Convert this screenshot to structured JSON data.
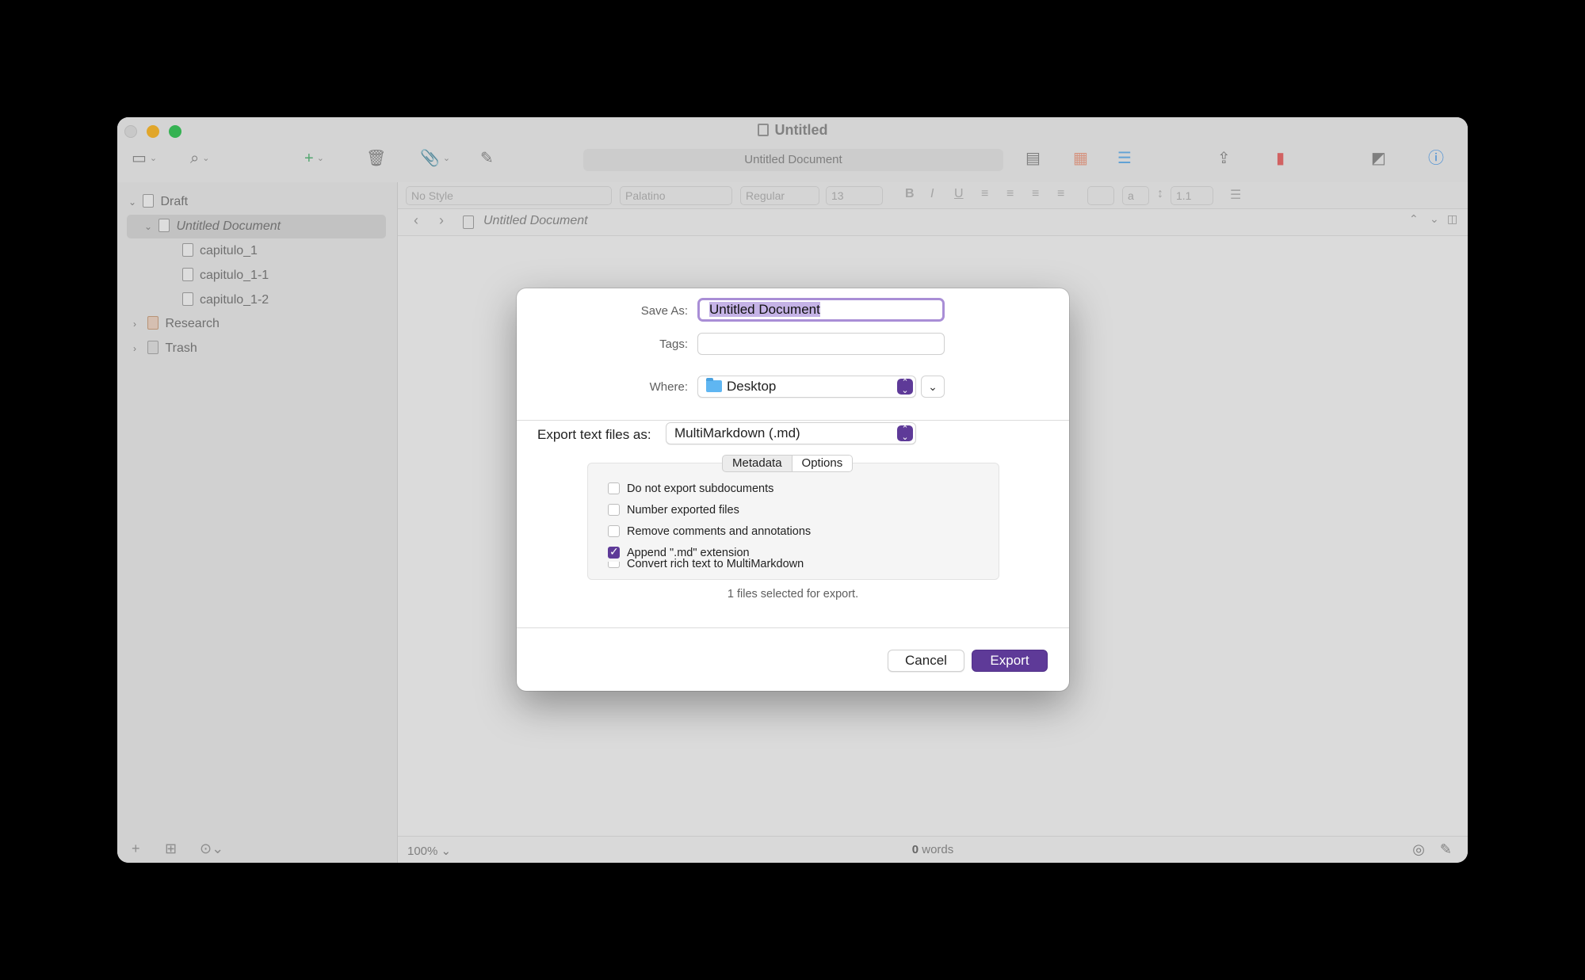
{
  "window": {
    "title": "Untitled",
    "toolbar_center_title": "Untitled Document"
  },
  "binder": {
    "items": [
      {
        "label": "Draft"
      },
      {
        "label": "Untitled Document"
      },
      {
        "label": "capitulo_1"
      },
      {
        "label": "capitulo_1-1"
      },
      {
        "label": "capitulo_1-2"
      },
      {
        "label": "Research"
      },
      {
        "label": "Trash"
      }
    ]
  },
  "format_bar": {
    "style": "No Style",
    "font": "Palatino",
    "weight": "Regular",
    "size": "13",
    "line_spacing": "1.1",
    "bold": "B",
    "italic": "I",
    "underline": "U",
    "highlight": "a"
  },
  "editor_header": {
    "document": "Untitled Document"
  },
  "status_bar": {
    "zoom": "100%",
    "word_count": "0",
    "word_label": "words"
  },
  "dialog": {
    "save_as_label": "Save As:",
    "save_as_value": "Untitled Document",
    "tags_label": "Tags:",
    "tags_value": "",
    "where_label": "Where:",
    "where_value": "Desktop",
    "export_label": "Export text files as:",
    "export_format": "MultiMarkdown (.md)",
    "tabs": [
      {
        "label": "Metadata",
        "active": false
      },
      {
        "label": "Options",
        "active": true
      }
    ],
    "options": [
      {
        "label": "Do not export subdocuments",
        "checked": false
      },
      {
        "label": "Number exported files",
        "checked": false
      },
      {
        "label": "Remove comments and annotations",
        "checked": false
      },
      {
        "label": "Append \".md\" extension",
        "checked": true
      },
      {
        "label": "Convert rich text to MultiMarkdown",
        "checked": false
      }
    ],
    "files_note": "1 files selected for export.",
    "cancel_label": "Cancel",
    "export_button_label": "Export"
  },
  "colors": {
    "accent": "#5e3a98",
    "selection": "#c5b3e6",
    "traffic_min": "#f5b52e",
    "traffic_max": "#3ac25a"
  }
}
